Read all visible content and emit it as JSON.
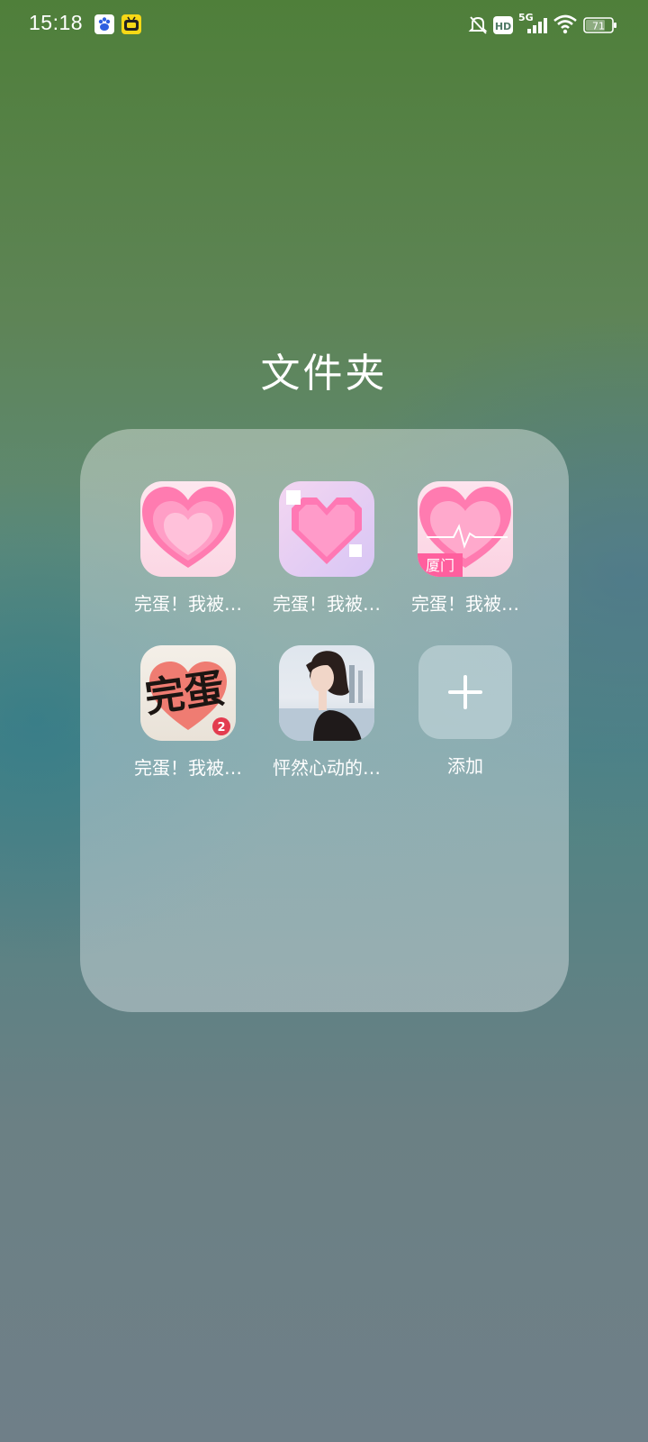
{
  "status_bar": {
    "time": "15:18",
    "network": "5G",
    "hd": "HD",
    "battery": "71",
    "icons": [
      "baidu-icon",
      "bilibili-tv-icon",
      "mute-bell-icon",
      "hd-icon",
      "signal-icon",
      "wifi-icon",
      "battery-icon"
    ]
  },
  "folder": {
    "title": "文件夹",
    "apps": [
      {
        "label": "完蛋！我被…",
        "icon": "pink-heart-app-icon"
      },
      {
        "label": "完蛋！我被…",
        "icon": "pixel-heart-app-icon"
      },
      {
        "label": "完蛋！我被…",
        "icon": "heart-xiamen-app-icon",
        "icon_text": "厦门"
      },
      {
        "label": "完蛋！我被…",
        "icon": "calligraphy-app-icon",
        "icon_text": "完蛋",
        "badge": "2"
      },
      {
        "label": "怦然心动的…",
        "icon": "portrait-app-icon"
      },
      {
        "label": "添加",
        "icon": "plus-icon"
      }
    ]
  }
}
